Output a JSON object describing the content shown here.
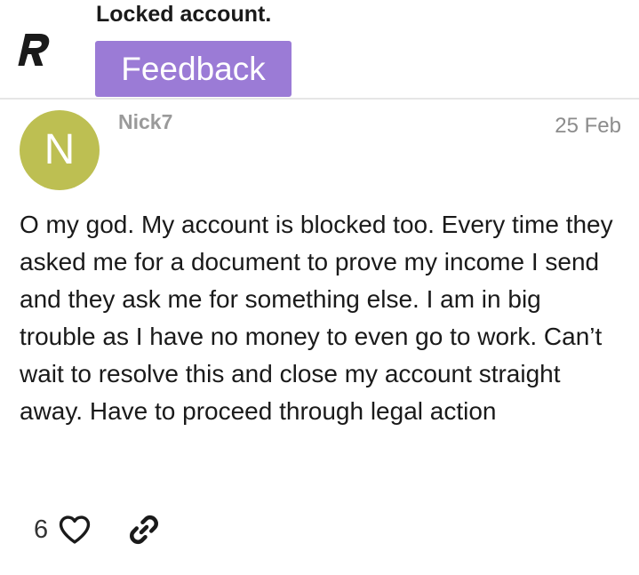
{
  "topic": {
    "title": "Locked account.",
    "category": "Feedback",
    "category_color": "#9b7bd6",
    "logo_icon": "revolut-r-logo"
  },
  "post": {
    "author": "Nick7",
    "avatar_letter": "N",
    "avatar_color": "#bdbf52",
    "date": "25 Feb",
    "body": "O my god. My account is blocked too. Every time they asked me for a document to prove my income I send and they ask me for something else. I am in big trouble as I have no money to even go to work. Can’t wait to resolve this and close my account straight away. Have to proceed through legal action",
    "like_count": "6",
    "like_icon": "heart-icon",
    "share_icon": "link-icon"
  }
}
